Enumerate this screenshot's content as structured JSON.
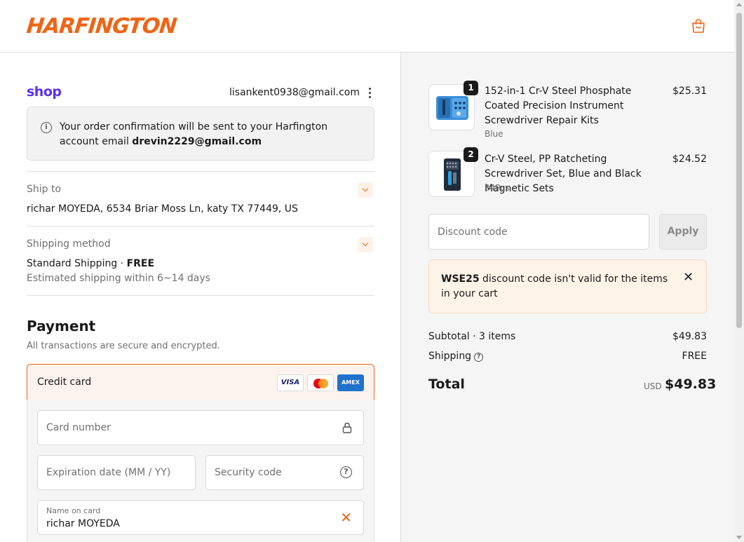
{
  "header": {
    "brand": "HARFINGTON",
    "cart_icon": "shopping-bag-icon",
    "accent": "#f06414"
  },
  "account": {
    "shop_brand": "shop",
    "email": "lisankent0938@gmail.com",
    "menu_icon": "kebab-menu-icon"
  },
  "notice": {
    "text_prefix": "Your order confirmation will be sent to your Harfington account email ",
    "email": "drevin2229@gmail.com"
  },
  "ship_to": {
    "label": "Ship to",
    "value": "richar MOYEDA, 6534 Briar Moss Ln, katy TX 77449, US"
  },
  "shipping_method": {
    "label": "Shipping method",
    "value": "Standard Shipping · ",
    "price": "FREE",
    "eta": "Estimated shipping within 6~14 days"
  },
  "payment": {
    "title": "Payment",
    "subtitle": "All transactions are secure and encrypted.",
    "method_label": "Credit card",
    "card_brands": [
      "VISA",
      "mastercard",
      "AMEX"
    ],
    "card_number_placeholder": "Card number",
    "expiry_placeholder": "Expiration date (MM / YY)",
    "security_placeholder": "Security code",
    "name_label": "Name on card",
    "name_value": "richar MOYEDA"
  },
  "cart": {
    "items": [
      {
        "qty": "1",
        "title": "152-in-1 Cr-V Steel Phosphate Coated Precision Instrument Screwdriver Repair Kits",
        "variant": "Blue",
        "price": "$25.31"
      },
      {
        "qty": "2",
        "title": "Cr-V Steel, PP Ratcheting Screwdriver Set, Blue and Black Magnetic Sets",
        "variant": "34Pcs",
        "price": "$24.52"
      }
    ]
  },
  "discount": {
    "placeholder": "Discount code",
    "apply_label": "Apply",
    "error_code": "WSE25",
    "error_text": " discount code isn't valid for the items in your cart"
  },
  "summary": {
    "subtotal_label": "Subtotal · 3 items",
    "subtotal_value": "$49.83",
    "shipping_label": "Shipping",
    "shipping_value": "FREE",
    "total_label": "Total",
    "currency": "USD",
    "total_value": "$49.83"
  }
}
